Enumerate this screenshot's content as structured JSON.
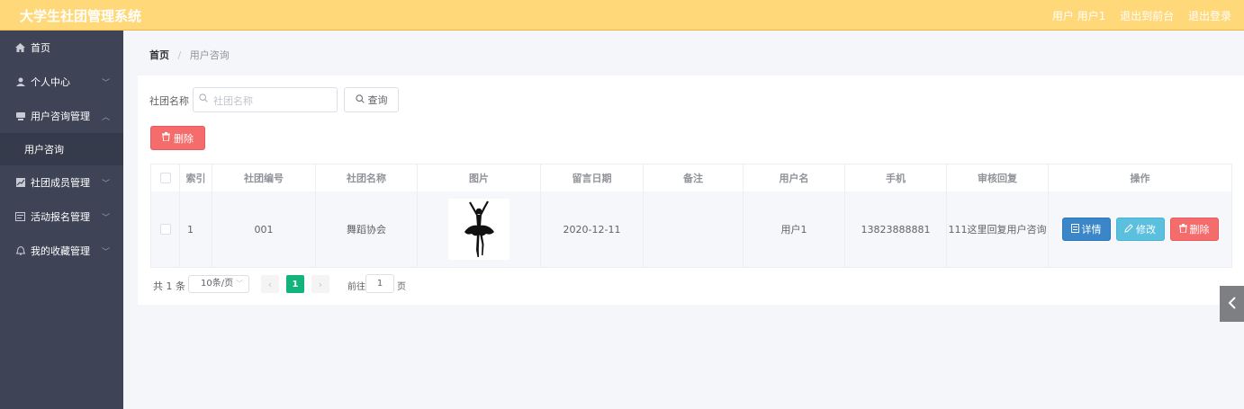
{
  "header": {
    "title": "大学生社团管理系统",
    "user_label": "用户 用户1",
    "to_frontend": "退出到前台",
    "logout": "退出登录"
  },
  "sidebar": {
    "items": [
      {
        "label": "首页",
        "icon": "home-icon"
      },
      {
        "label": "个人中心",
        "icon": "user-icon",
        "chevron": "down"
      },
      {
        "label": "用户咨询管理",
        "icon": "message-icon",
        "chevron": "up"
      },
      {
        "label": "用户咨询",
        "sub": true
      },
      {
        "label": "社团成员管理",
        "icon": "chart-icon",
        "chevron": "down"
      },
      {
        "label": "活动报名管理",
        "icon": "list-icon",
        "chevron": "down"
      },
      {
        "label": "我的收藏管理",
        "icon": "bell-icon",
        "chevron": "down"
      }
    ]
  },
  "breadcrumb": {
    "home": "首页",
    "separator": "/",
    "current": "用户咨询"
  },
  "search": {
    "label": "社团名称",
    "placeholder": "社团名称",
    "value": "",
    "query_button": "查询"
  },
  "actions": {
    "delete_button": "删除"
  },
  "table": {
    "headers": [
      "索引",
      "社团编号",
      "社团名称",
      "图片",
      "留言日期",
      "备注",
      "用户名",
      "手机",
      "审核回复",
      "操作"
    ],
    "rows": [
      {
        "index": "1",
        "club_no": "001",
        "club_name": "舞蹈协会",
        "image": "ballet-dancer-silhouette",
        "date": "2020-12-11",
        "remark": "",
        "username": "用户1",
        "phone": "13823888881",
        "reply": "111这里回复用户咨询"
      }
    ],
    "row_actions": {
      "detail": "详情",
      "edit": "修改",
      "delete": "删除"
    }
  },
  "pagination": {
    "total": "共 1 条",
    "page_size": "10条/页",
    "current_page": "1",
    "goto_label": "前往",
    "goto_value": "1",
    "page_suffix": "页"
  },
  "colors": {
    "header_bg": "#ffd87a",
    "sidebar_bg": "#3e4456",
    "danger": "#f56c6c",
    "primary": "#3a86c8",
    "info": "#5bc0de",
    "pagination_active": "#13b37c"
  }
}
